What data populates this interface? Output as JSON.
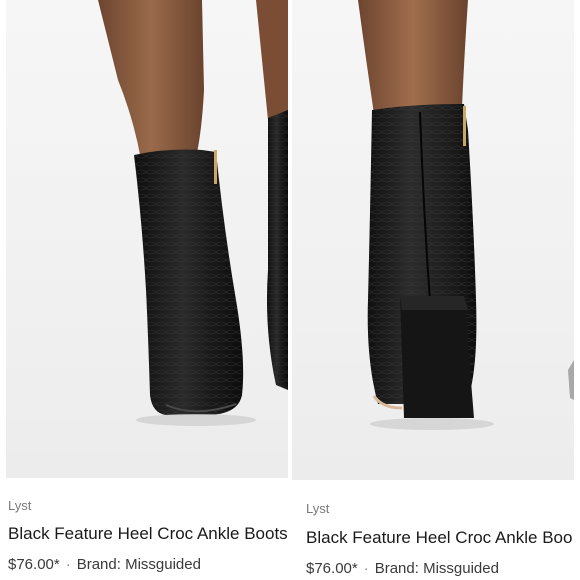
{
  "products": [
    {
      "store": "Lyst",
      "title": "Black Feature Heel Croc Ankle Boots",
      "price": "$76.00*",
      "separator": "·",
      "brand": "Brand: Missguided",
      "image_icon": "boot-front-photo"
    },
    {
      "store": "Lyst",
      "title": "Black Feature Heel Croc Ankle Boo",
      "price": "$76.00*",
      "separator": "·",
      "brand": "Brand: Missguided",
      "image_icon": "boot-back-photo"
    }
  ],
  "colors": {
    "text_primary": "#1a1a1a",
    "text_secondary": "#7a7a7a",
    "boot_leather": "#1b1b1b",
    "skin": "#8a5a3c"
  }
}
